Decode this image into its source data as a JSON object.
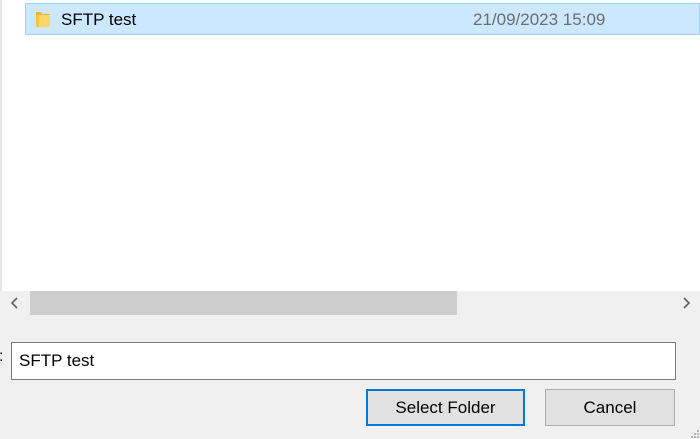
{
  "file_list": {
    "rows": [
      {
        "name": "SFTP test",
        "date_modified": "21/09/2023 15:09",
        "icon": "folder-icon",
        "selected": true
      }
    ]
  },
  "scrollbar": {
    "left_arrow": "<",
    "right_arrow": ">"
  },
  "name_field": {
    "label": ":",
    "value": "SFTP test"
  },
  "buttons": {
    "select_folder": "Select Folder",
    "cancel": "Cancel"
  },
  "colors": {
    "selection_bg": "#cce8ff",
    "selection_border": "#99d1ff",
    "default_button_border": "#0078d7",
    "folder_yellow": "#ffd766"
  }
}
